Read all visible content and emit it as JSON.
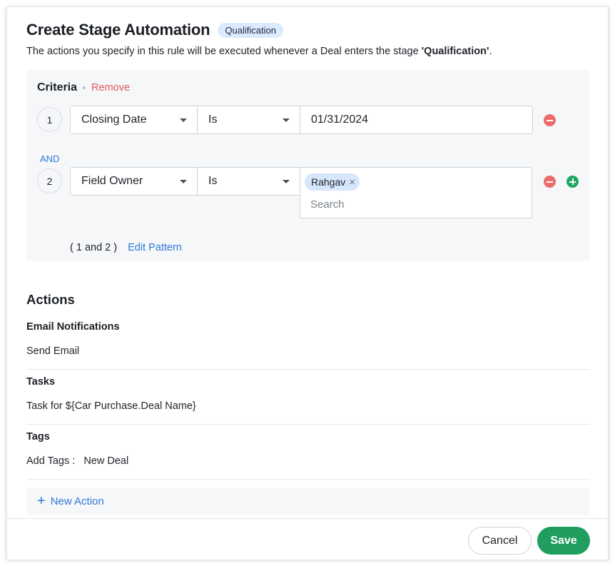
{
  "dialog": {
    "title": "Create Stage Automation",
    "stage_badge": "Qualification",
    "description_prefix": "The actions you specify in this rule will be executed whenever a Deal enters the stage ",
    "description_stage": "'Qualification'",
    "description_suffix": "."
  },
  "criteria": {
    "title": "Criteria",
    "remove_label": "Remove",
    "conjunction": "AND",
    "rows": [
      {
        "number": "1",
        "field": "Closing Date",
        "operator": "Is",
        "value": "01/31/2024"
      },
      {
        "number": "2",
        "field": "Field Owner",
        "operator": "Is",
        "chips": [
          "Rahgav"
        ],
        "search_placeholder": "Search"
      }
    ],
    "pattern_text": "( 1 and 2 )",
    "edit_pattern_label": "Edit Pattern"
  },
  "actions": {
    "title": "Actions",
    "sections": [
      {
        "label": "Email Notifications",
        "value": "Send Email"
      },
      {
        "label": "Tasks",
        "value": "Task for ${Car Purchase.Deal Name}"
      },
      {
        "label": "Tags",
        "value": "Add Tags :   New Deal"
      }
    ],
    "new_action_label": "New Action"
  },
  "footer": {
    "cancel_label": "Cancel",
    "save_label": "Save"
  },
  "icons": {
    "dropdown": "chevron-down-icon",
    "remove_row": "minus-circle-icon",
    "add_row": "plus-circle-icon",
    "chip_remove": "close-icon",
    "new_action": "plus-icon"
  },
  "colors": {
    "accent_blue": "#2d7ad6",
    "remove_red": "#ee6b6b",
    "add_green": "#1fa664",
    "save_green": "#1f9e5f",
    "badge_bg": "#dbeafe",
    "chip_bg": "#d6e7fb"
  }
}
